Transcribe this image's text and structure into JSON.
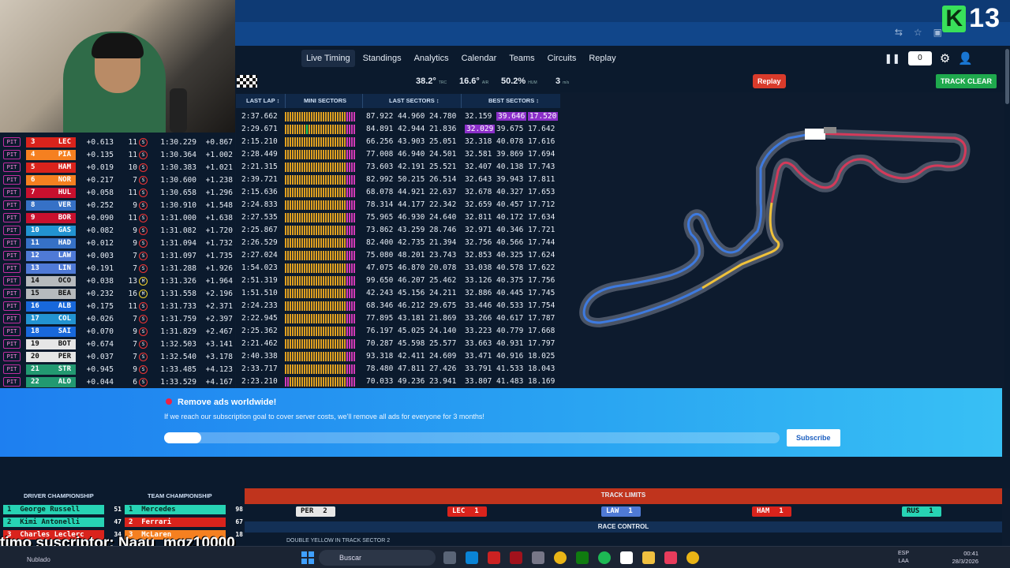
{
  "overlay": {
    "k_badge": "K",
    "k_number": "13"
  },
  "nav": {
    "tabs": [
      "Live Timing",
      "Standings",
      "Analytics",
      "Calendar",
      "Teams",
      "Circuits",
      "Replay"
    ],
    "counter": "0"
  },
  "weather": {
    "track": "38.2°",
    "track_unit": "TRC",
    "air": "16.6°",
    "air_unit": "AIR",
    "humidity": "50.2%",
    "humidity_unit": "HUM",
    "wind": "3",
    "wind_unit": "m/s"
  },
  "buttons": {
    "replay": "Replay",
    "track_clear": "TRACK CLEAR"
  },
  "timing_headers": {
    "last_lap": "LAST LAP ↕",
    "mini_sectors": "MINI SECTORS",
    "last_sectors": "LAST SECTORS ↕",
    "best_sectors": "BEST SECTORS ↕"
  },
  "top_rows": [
    {
      "last_lap": "2:37.662",
      "ls": [
        "87.922",
        "44.960",
        "24.780"
      ],
      "bs": [
        "32.159",
        "39.646",
        "17.520"
      ]
    },
    {
      "last_lap": "2:29.671",
      "ls": [
        "84.891",
        "42.944",
        "21.836"
      ],
      "bs": [
        "32.029",
        "39.675",
        "17.642"
      ]
    }
  ],
  "drivers": [
    {
      "pit": "PIT",
      "pos": "3",
      "code": "LEC",
      "color": "#d9231c",
      "int": "+0.613",
      "laps": "11",
      "tyre": "S",
      "lap": "1:30.229",
      "gap": "+0.867",
      "last_lap": "2:15.210",
      "ls": [
        "66.256",
        "43.903",
        "25.051"
      ],
      "bs": [
        "32.318",
        "40.078",
        "17.616"
      ]
    },
    {
      "pit": "PIT",
      "pos": "4",
      "code": "PIA",
      "color": "#f58020",
      "int": "+0.135",
      "laps": "11",
      "tyre": "S",
      "lap": "1:30.364",
      "gap": "+1.002",
      "last_lap": "2:28.449",
      "ls": [
        "77.008",
        "46.940",
        "24.501"
      ],
      "bs": [
        "32.581",
        "39.869",
        "17.694"
      ]
    },
    {
      "pit": "PIT",
      "pos": "5",
      "code": "HAM",
      "color": "#d9231c",
      "int": "+0.019",
      "laps": "10",
      "tyre": "S",
      "lap": "1:30.383",
      "gap": "+1.021",
      "last_lap": "2:21.315",
      "ls": [
        "73.603",
        "42.191",
        "25.521"
      ],
      "bs": [
        "32.407",
        "40.138",
        "17.743"
      ]
    },
    {
      "pit": "PIT",
      "pos": "6",
      "code": "NOR",
      "color": "#f58020",
      "int": "+0.217",
      "laps": "7",
      "tyre": "S",
      "lap": "1:30.600",
      "gap": "+1.238",
      "last_lap": "2:39.721",
      "ls": [
        "82.992",
        "50.215",
        "26.514"
      ],
      "bs": [
        "32.643",
        "39.943",
        "17.811"
      ]
    },
    {
      "pit": "PIT",
      "pos": "7",
      "code": "HUL",
      "color": "#c8102e",
      "int": "+0.058",
      "laps": "11",
      "tyre": "S",
      "lap": "1:30.658",
      "gap": "+1.296",
      "last_lap": "2:15.636",
      "ls": [
        "68.078",
        "44.921",
        "22.637"
      ],
      "bs": [
        "32.678",
        "40.327",
        "17.653"
      ]
    },
    {
      "pit": "PIT",
      "pos": "8",
      "code": "VER",
      "color": "#3671c6",
      "int": "+0.252",
      "laps": "9",
      "tyre": "S",
      "lap": "1:30.910",
      "gap": "+1.548",
      "last_lap": "2:24.833",
      "ls": [
        "78.314",
        "44.177",
        "22.342"
      ],
      "bs": [
        "32.659",
        "40.457",
        "17.712"
      ]
    },
    {
      "pit": "PIT",
      "pos": "9",
      "code": "BOR",
      "color": "#c8102e",
      "int": "+0.090",
      "laps": "11",
      "tyre": "S",
      "lap": "1:31.000",
      "gap": "+1.638",
      "last_lap": "2:27.535",
      "ls": [
        "75.965",
        "46.930",
        "24.640"
      ],
      "bs": [
        "32.811",
        "40.172",
        "17.634"
      ]
    },
    {
      "pit": "PIT",
      "pos": "10",
      "code": "GAS",
      "color": "#2293d1",
      "int": "+0.082",
      "laps": "9",
      "tyre": "S",
      "lap": "1:31.082",
      "gap": "+1.720",
      "last_lap": "2:25.867",
      "ls": [
        "73.862",
        "43.259",
        "28.746"
      ],
      "bs": [
        "32.971",
        "40.346",
        "17.721"
      ]
    },
    {
      "pit": "PIT",
      "pos": "11",
      "code": "HAD",
      "color": "#3671c6",
      "int": "+0.012",
      "laps": "9",
      "tyre": "S",
      "lap": "1:31.094",
      "gap": "+1.732",
      "last_lap": "2:26.529",
      "ls": [
        "82.400",
        "42.735",
        "21.394"
      ],
      "bs": [
        "32.756",
        "40.566",
        "17.744"
      ]
    },
    {
      "pit": "PIT",
      "pos": "12",
      "code": "LAW",
      "color": "#4f7ad6",
      "int": "+0.003",
      "laps": "7",
      "tyre": "S",
      "lap": "1:31.097",
      "gap": "+1.735",
      "last_lap": "2:27.024",
      "ls": [
        "75.080",
        "48.201",
        "23.743"
      ],
      "bs": [
        "32.853",
        "40.325",
        "17.624"
      ]
    },
    {
      "pit": "PIT",
      "pos": "13",
      "code": "LIN",
      "color": "#4f7ad6",
      "int": "+0.191",
      "laps": "7",
      "tyre": "S",
      "lap": "1:31.288",
      "gap": "+1.926",
      "last_lap": "1:54.023",
      "ls": [
        "47.075",
        "46.870",
        "20.078"
      ],
      "bs": [
        "33.038",
        "40.578",
        "17.622"
      ]
    },
    {
      "pit": "PIT",
      "pos": "14",
      "code": "OCO",
      "color": "#b6babd",
      "int": "+0.038",
      "laps": "13",
      "tyre": "M",
      "lap": "1:31.326",
      "gap": "+1.964",
      "last_lap": "2:51.319",
      "ls": [
        "99.650",
        "46.207",
        "25.462"
      ],
      "bs": [
        "33.126",
        "40.375",
        "17.756"
      ]
    },
    {
      "pit": "PIT",
      "pos": "15",
      "code": "BEA",
      "color": "#b6babd",
      "int": "+0.232",
      "laps": "16",
      "tyre": "M",
      "lap": "1:31.558",
      "gap": "+2.196",
      "last_lap": "1:51.510",
      "ls": [
        "42.243",
        "45.156",
        "24.211"
      ],
      "bs": [
        "32.886",
        "40.445",
        "17.745"
      ]
    },
    {
      "pit": "PIT",
      "pos": "16",
      "code": "ALB",
      "color": "#1868db",
      "int": "+0.175",
      "laps": "11",
      "tyre": "S",
      "lap": "1:31.733",
      "gap": "+2.371",
      "last_lap": "2:24.233",
      "ls": [
        "68.346",
        "46.212",
        "29.675"
      ],
      "bs": [
        "33.446",
        "40.533",
        "17.754"
      ]
    },
    {
      "pit": "PIT",
      "pos": "17",
      "code": "COL",
      "color": "#2293d1",
      "int": "+0.026",
      "laps": "7",
      "tyre": "S",
      "lap": "1:31.759",
      "gap": "+2.397",
      "last_lap": "2:22.945",
      "ls": [
        "77.895",
        "43.181",
        "21.869"
      ],
      "bs": [
        "33.266",
        "40.617",
        "17.787"
      ]
    },
    {
      "pit": "PIT",
      "pos": "18",
      "code": "SAI",
      "color": "#1868db",
      "int": "+0.070",
      "laps": "9",
      "tyre": "S",
      "lap": "1:31.829",
      "gap": "+2.467",
      "last_lap": "2:25.362",
      "ls": [
        "76.197",
        "45.025",
        "24.140"
      ],
      "bs": [
        "33.223",
        "40.779",
        "17.668"
      ]
    },
    {
      "pit": "PIT",
      "pos": "19",
      "code": "BOT",
      "color": "#e6e6e6",
      "int": "+0.674",
      "laps": "7",
      "tyre": "S",
      "lap": "1:32.503",
      "gap": "+3.141",
      "last_lap": "2:21.462",
      "ls": [
        "70.287",
        "45.598",
        "25.577"
      ],
      "bs": [
        "33.663",
        "40.931",
        "17.797"
      ]
    },
    {
      "pit": "PIT",
      "pos": "20",
      "code": "PER",
      "color": "#e6e6e6",
      "int": "+0.037",
      "laps": "7",
      "tyre": "S",
      "lap": "1:32.540",
      "gap": "+3.178",
      "last_lap": "2:40.338",
      "ls": [
        "93.318",
        "42.411",
        "24.609"
      ],
      "bs": [
        "33.471",
        "40.916",
        "18.025"
      ]
    },
    {
      "pit": "PIT",
      "pos": "21",
      "code": "STR",
      "color": "#229971",
      "int": "+0.945",
      "laps": "9",
      "tyre": "S",
      "lap": "1:33.485",
      "gap": "+4.123",
      "last_lap": "2:33.717",
      "ls": [
        "78.480",
        "47.811",
        "27.426"
      ],
      "bs": [
        "33.791",
        "41.533",
        "18.043"
      ]
    },
    {
      "pit": "PIT",
      "pos": "22",
      "code": "ALO",
      "color": "#229971",
      "int": "+0.044",
      "laps": "6",
      "tyre": "S",
      "lap": "1:33.529",
      "gap": "+4.167",
      "last_lap": "2:23.210",
      "ls": [
        "70.033",
        "49.236",
        "23.941"
      ],
      "bs": [
        "33.807",
        "41.483",
        "18.169"
      ]
    }
  ],
  "ad": {
    "title": "Remove ads worldwide!",
    "subtitle": "If we reach our subscription goal to cover server costs, we'll remove all ads for everyone for 3 months!",
    "progress": 0.06,
    "button": "Subscribe"
  },
  "driver_champ": {
    "title": "DRIVER CHAMPIONSHIP",
    "rows": [
      {
        "pos": "1",
        "name": "George Russell",
        "pts": "51",
        "color": "#27d3b4"
      },
      {
        "pos": "2",
        "name": "Kimi Antonelli",
        "pts": "47",
        "color": "#27d3b4"
      },
      {
        "pos": "3",
        "name": "Charles Leclerc",
        "pts": "34",
        "color": "#d9231c"
      }
    ]
  },
  "team_champ": {
    "title": "TEAM CHAMPIONSHIP",
    "rows": [
      {
        "pos": "1",
        "name": "Mercedes",
        "pts": "98",
        "color": "#27d3b4"
      },
      {
        "pos": "2",
        "name": "Ferrari",
        "pts": "67",
        "color": "#d9231c"
      },
      {
        "pos": "3",
        "name": "McLaren",
        "pts": "18",
        "color": "#f58020"
      }
    ]
  },
  "track_limits": {
    "title": "TRACK LIMITS",
    "items": [
      {
        "code": "PER",
        "count": "2",
        "color": "#e6e6e6"
      },
      {
        "code": "LEC",
        "count": "1",
        "color": "#d9231c"
      },
      {
        "code": "LAW",
        "count": "1",
        "color": "#4f7ad6"
      },
      {
        "code": "HAM",
        "count": "1",
        "color": "#d9231c"
      },
      {
        "code": "RUS",
        "count": "1",
        "color": "#27d3b4"
      }
    ]
  },
  "race_control": {
    "title": "RACE CONTROL",
    "message": "DOUBLE YELLOW IN TRACK SECTOR 2"
  },
  "subscriber": {
    "text": "timo suscriptor: Naau_mqz10000"
  },
  "taskbar": {
    "weather": "Nublado",
    "search": "Buscar",
    "lang1": "ESP",
    "lang2": "LAA",
    "time": "00:41",
    "date": "28/3/2026"
  }
}
